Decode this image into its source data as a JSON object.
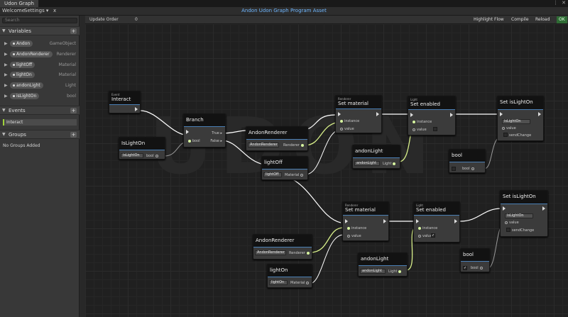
{
  "window": {
    "tab_title": "Udon Graph",
    "menu_dots": "⋮",
    "close": "✕"
  },
  "toolbar": {
    "welcome": "Welcome",
    "settings": "Settings ▾",
    "close_x": "x",
    "asset_title": "Andon Udon Graph Program Asset"
  },
  "sidebar": {
    "search_placeholder": "Search",
    "variables_label": "Variables",
    "variables": [
      {
        "name": "Andon",
        "type": "GameObject"
      },
      {
        "name": "AndonRenderer",
        "type": "Renderer"
      },
      {
        "name": "lightOff",
        "type": "Material"
      },
      {
        "name": "lightOn",
        "type": "Material"
      },
      {
        "name": "andonLight",
        "type": "Light"
      },
      {
        "name": "isLightOn",
        "type": "bool"
      }
    ],
    "events_label": "Events",
    "events": [
      "Interact"
    ],
    "groups_label": "Groups",
    "no_groups": "No Groups Added",
    "plus": "+"
  },
  "graph_toolbar": {
    "update_order_label": "Update Order",
    "update_order_value": "0",
    "highlight_flow": "Highlight Flow",
    "compile": "Compile",
    "reload": "Reload",
    "ok": "OK"
  },
  "nodes": {
    "event_interact": {
      "sub": "Event",
      "title": "Interact"
    },
    "branch": {
      "title": "Branch",
      "true": "True",
      "false": "False",
      "bool": "bool"
    },
    "get_islighton": {
      "title": "IsLightOn",
      "dropdown": "isLightOn",
      "port": "bool"
    },
    "andon_renderer_1": {
      "title": "AndonRenderer",
      "dropdown": "AndonRenderer",
      "port": "Renderer"
    },
    "lightoff": {
      "title": "lightOff",
      "dropdown": "lightOff",
      "port": "Material"
    },
    "set_material_1": {
      "sub": "Renderer",
      "title": "Set material",
      "instance": "instance",
      "value": "value"
    },
    "set_enabled_1": {
      "sub": "Light",
      "title": "Set enabled",
      "instance": "instance",
      "value": "value"
    },
    "andonlight_1": {
      "title": "andonLight",
      "dropdown": "andonLight",
      "port": "Light"
    },
    "set_islighton_1": {
      "title": "Set isLightOn",
      "dropdown": "isLightOn",
      "value": "value",
      "send_change": "sendChange"
    },
    "bool_1": {
      "title": "bool",
      "port": "bool",
      "checked": false
    },
    "set_material_2": {
      "sub": "Renderer",
      "title": "Set material",
      "instance": "instance",
      "value": "value"
    },
    "set_enabled_2": {
      "sub": "Light",
      "title": "Set enabled",
      "instance": "instance",
      "value": "value",
      "checked": true
    },
    "andon_renderer_2": {
      "title": "AndonRenderer",
      "dropdown": "AndonRenderer",
      "port": "Renderer"
    },
    "andonlight_2": {
      "title": "andonLight",
      "dropdown": "andonLight",
      "port": "Light"
    },
    "lighton": {
      "title": "lightOn",
      "dropdown": "lightOn",
      "port": "Material"
    },
    "set_islighton_2": {
      "title": "Set isLightOn",
      "dropdown": "isLightOn",
      "value": "value",
      "send_change": "sendChange"
    },
    "bool_2": {
      "title": "bool",
      "port": "bool",
      "checked": true
    }
  },
  "colors": {
    "accent": "#4a7fb5",
    "wire_object": "#ffffff",
    "wire_bool": "#9a9a9a",
    "wire_light": "#d8f08a",
    "ok_bg": "#2e6b34",
    "event_marker": "#9fd23a"
  }
}
